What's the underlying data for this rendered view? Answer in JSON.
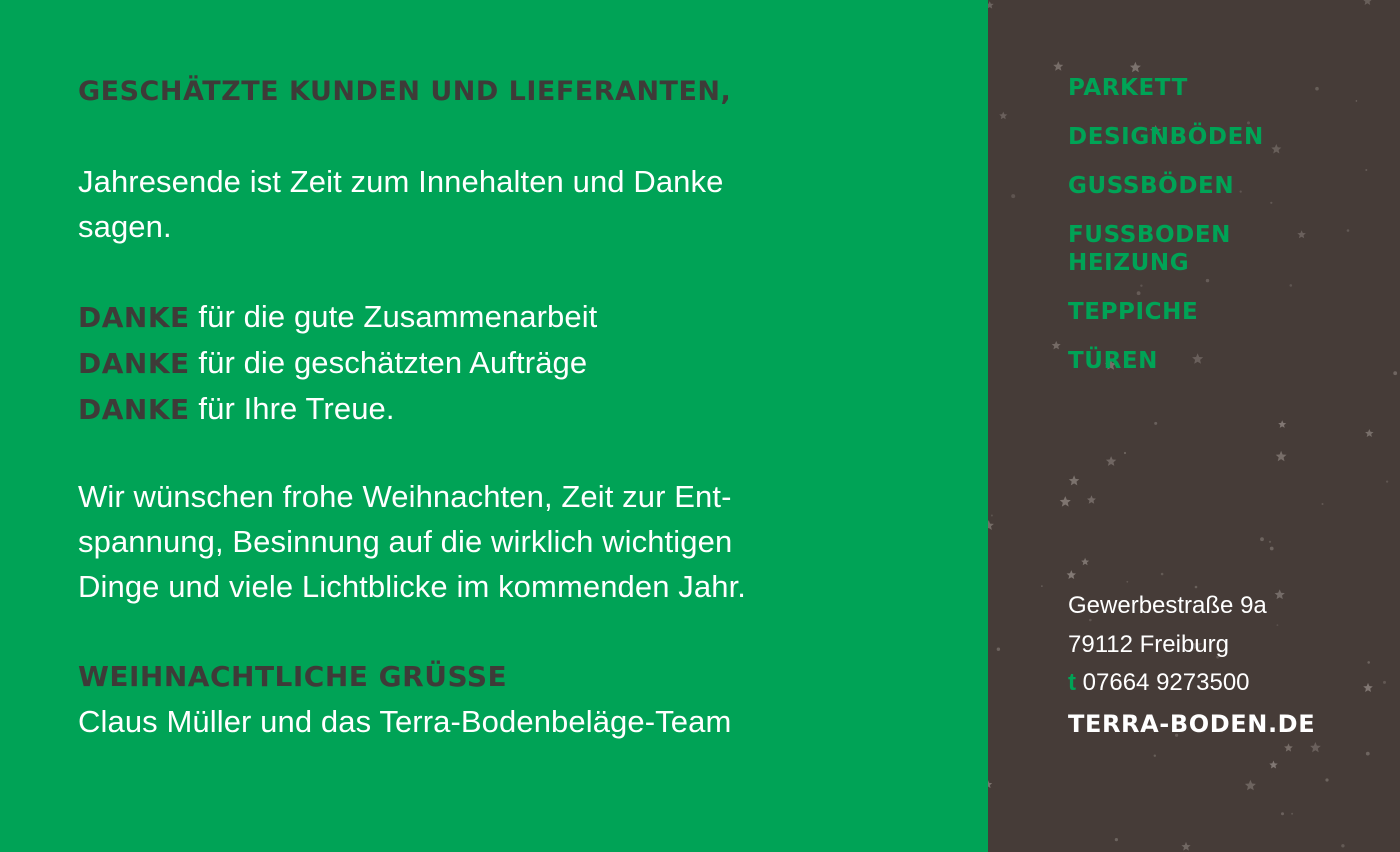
{
  "letter": {
    "headline": "GESCHÄTZTE KUNDEN UND LIEFERANTEN,",
    "intro_line1": "Jahresende ist Zeit zum Innehalten und Danke",
    "intro_line2": "sagen.",
    "thanks": [
      {
        "keyword": "DANKE",
        "text": " für die gute Zusammenarbeit"
      },
      {
        "keyword": "DANKE",
        "text": " für die geschätzten Aufträge"
      },
      {
        "keyword": "DANKE",
        "text": " für Ihre Treue."
      }
    ],
    "wish_line1": "Wir wünschen frohe Weihnachten, Zeit zur Ent-",
    "wish_line2": "spannung, Besinnung auf die wirklich wichtigen",
    "wish_line3": "Dinge und viele Lichtblicke im kommenden Jahr.",
    "greeting_heading": "WEIHNACHTLICHE GRÜSSE",
    "signature": "Claus Müller und das Terra-Bodenbeläge-Team"
  },
  "sidebar": {
    "menu": {
      "parkett": "PARKETT",
      "designboeden": "DESIGNBÖDEN",
      "gussboeden": "GUSSBÖDEN",
      "fussboden_line1": "FUSSBODEN",
      "fussboden_line2": "HEIZUNG",
      "teppiche": "TEPPICHE",
      "tueren": "TÜREN"
    },
    "address": {
      "street": "Gewerbestraße 9a",
      "city": "79112 Freiburg",
      "phone_prefix": "t",
      "phone": " 07664 9273500",
      "website": "TERRA-BODEN.DE"
    }
  },
  "colors": {
    "green": "#00a356",
    "dark_brown": "#463c38",
    "heading_dark": "#3e3b38",
    "white": "#ffffff"
  },
  "icons": [
    "star-icon"
  ]
}
